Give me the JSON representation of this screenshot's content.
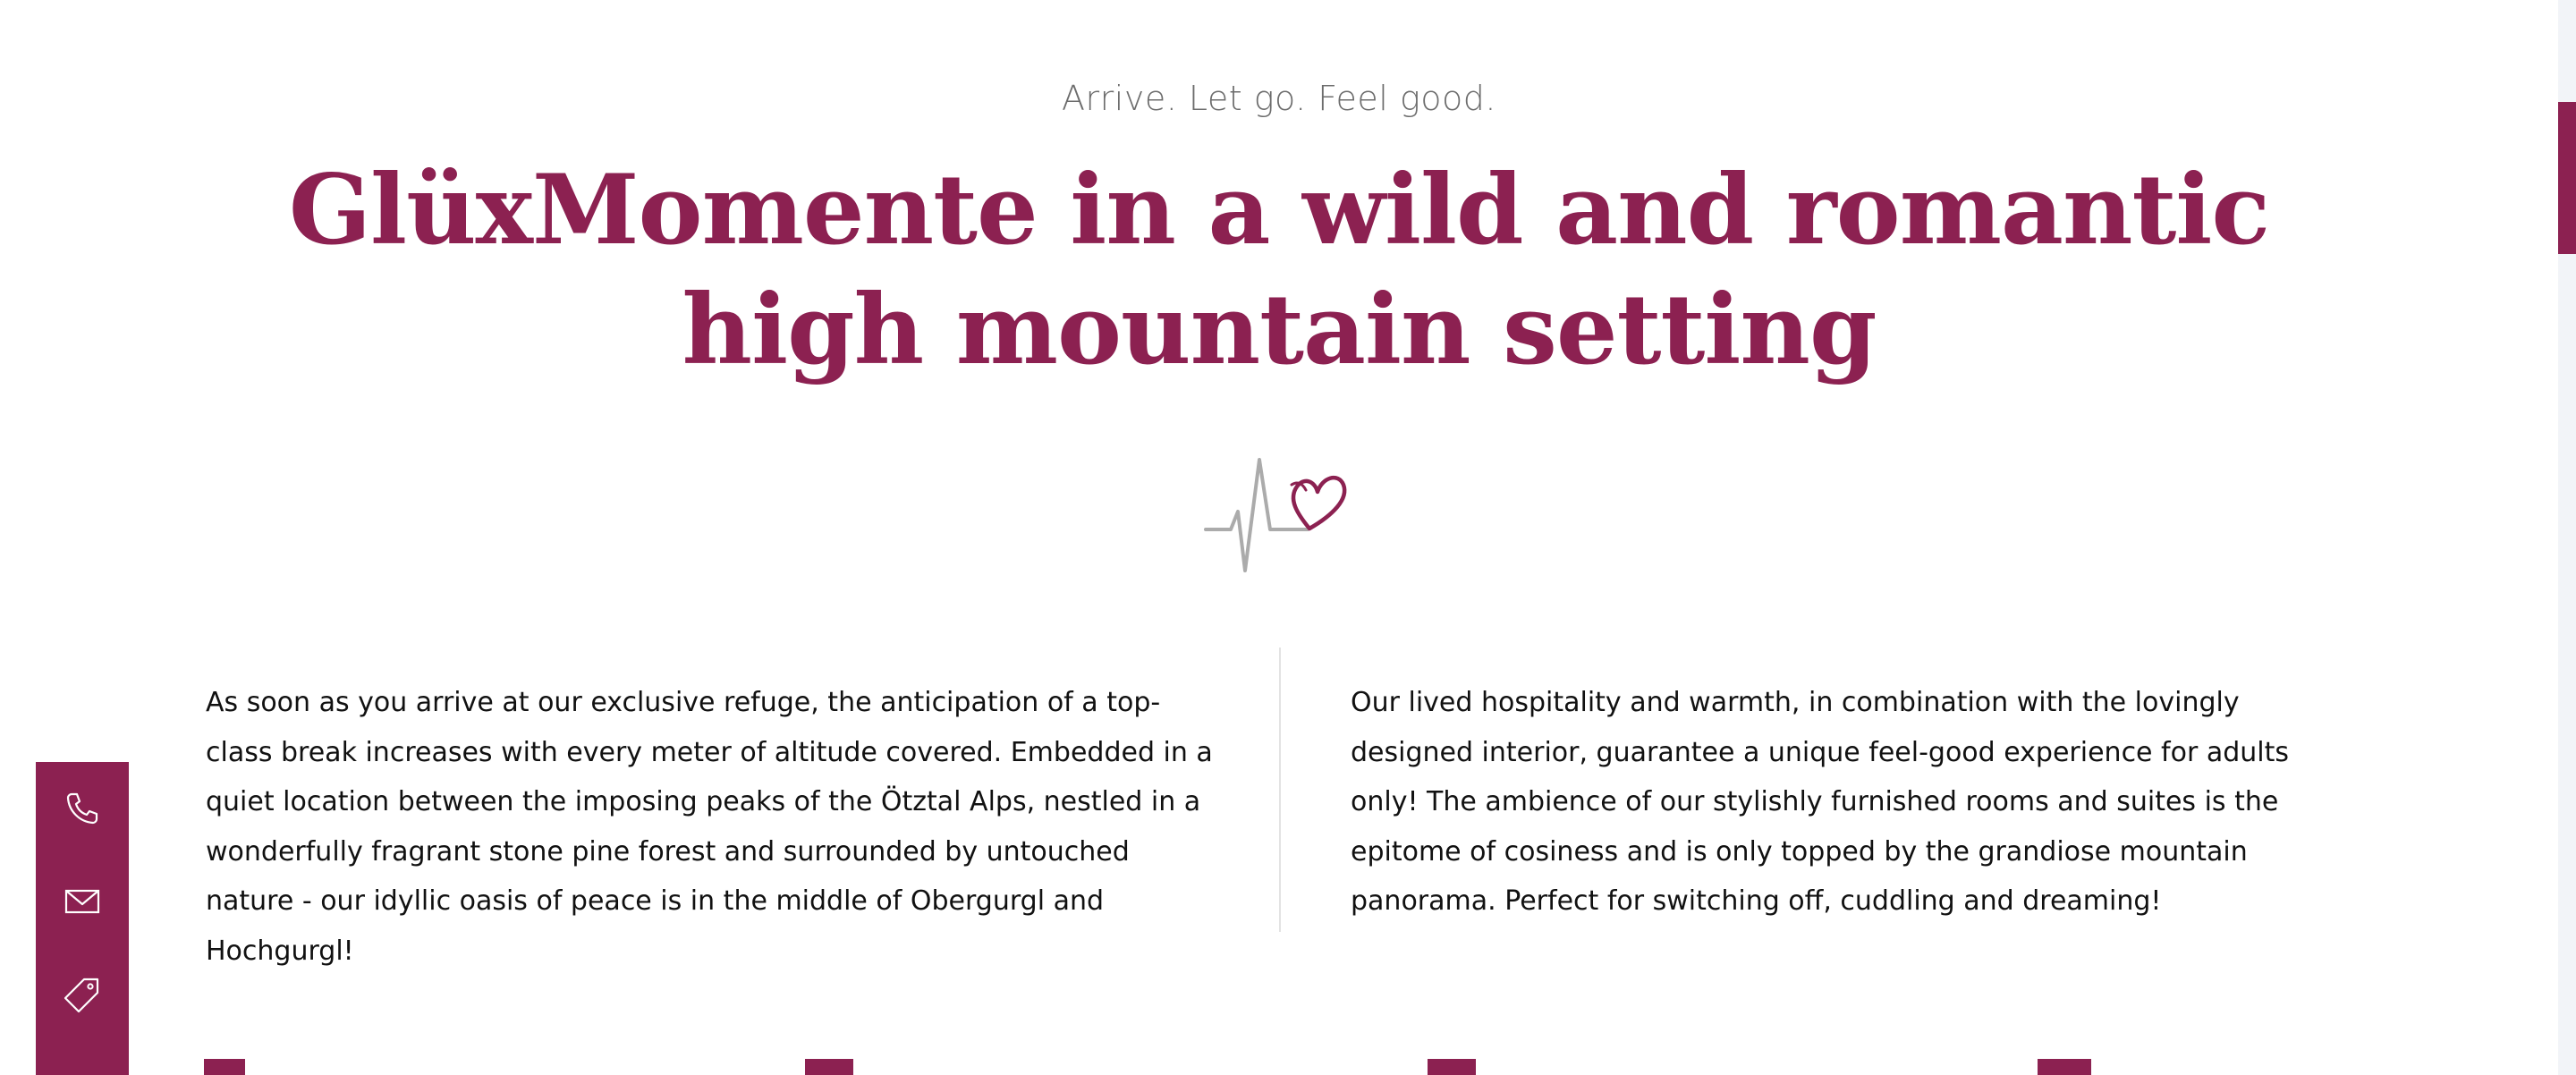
{
  "intro": {
    "tagline": "Arrive. Let go. Feel good.",
    "headline": "GlüxMomente in a wild and romantic high mountain setting",
    "divider_icon": "heartbeat-heart-icon"
  },
  "content": {
    "left_paragraph": "As soon as you arrive at our exclusive refuge, the anticipation of a top-class break increases with every meter of altitude covered. Embedded in a quiet location between the imposing peaks of the Ötztal Alps, nestled in a wonderfully fragrant stone pine forest and surrounded by untouched nature - our idyllic oasis of peace is in the middle of Obergurgl and Hochgurgl!",
    "right_paragraph": "Our lived hospitality and warmth, in combination with the lovingly designed interior, guarantee a unique feel-good experience for adults only! The ambience of our stylishly furnished rooms and suites is the epitome of cosiness and is only topped by the grandiose mountain panorama. Perfect for switching off, cuddling and dreaming!"
  },
  "contact_bar": {
    "items": [
      {
        "icon": "phone-icon"
      },
      {
        "icon": "mail-icon"
      },
      {
        "icon": "tag-icon"
      }
    ]
  },
  "colors": {
    "brand": "#8c2151",
    "text": "#111111",
    "muted": "#6c6c6c",
    "divider": "#e3e3e3",
    "scroll_track": "#f2f4f8"
  }
}
